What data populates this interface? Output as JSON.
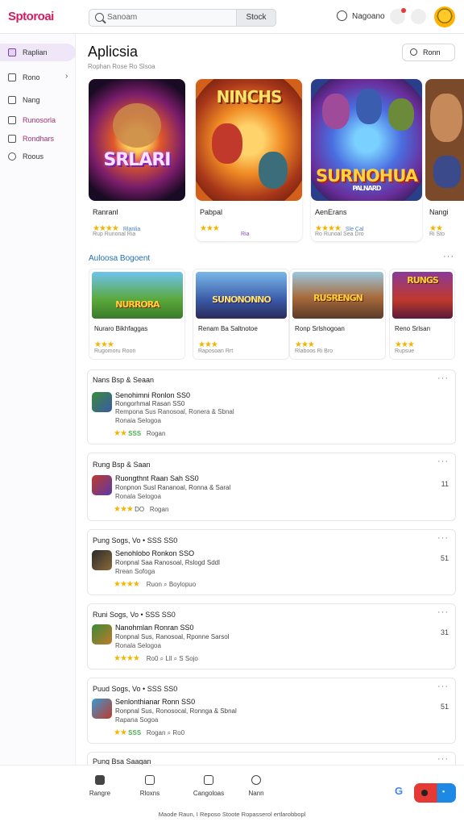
{
  "header": {
    "logo": "Sptoroai",
    "search_placeholder": "Sanoam",
    "search_button": "Stock",
    "user_label": "Nagoano"
  },
  "sidebar": {
    "items": [
      {
        "label": "Raplian",
        "active": true,
        "icon": "bag-icon"
      },
      {
        "label": "Rono",
        "chevron": "›",
        "icon": "grid-icon"
      },
      {
        "label": "Nang",
        "icon": "square-icon"
      },
      {
        "label": "Runosorla",
        "icon": "archive-icon"
      },
      {
        "label": "Rondhars",
        "icon": "chat-icon"
      },
      {
        "label": "Roous",
        "icon": "circle-icon"
      }
    ]
  },
  "page": {
    "title": "Aplicsia",
    "subtitle": "Rophan Rose Ro Slsoa",
    "search_button": "Ronn"
  },
  "featured": [
    {
      "art_title": "SRLARI",
      "name": "Ranranl",
      "stars": "★★★★",
      "meta": "Rlanlia",
      "sub": "Rup Runonal  Ria"
    },
    {
      "art_title": "NINCHS",
      "name": "Pabpal",
      "stars": "★★★",
      "meta": "",
      "sub": "Ria"
    },
    {
      "art_title": "SURNOHUA",
      "art_sub": "PALNARD",
      "name": "AenErans",
      "stars": "★★★★",
      "meta": "Sle Cal",
      "sub": "Ro Runoal Sea Dro"
    },
    {
      "art_title": "",
      "name": "Nangi",
      "stars": "★★",
      "meta": "",
      "sub": "Ri Sto"
    }
  ],
  "recommended": {
    "heading": "Auloosa Bogoent",
    "items": [
      {
        "art_title": "NURRORA",
        "name": "Nuraro Bikhfaggas",
        "stars": "★★★",
        "sub": "Rugomoru  Roon"
      },
      {
        "art_title": "SUNONONNO",
        "name": "Renam Ba Saltnotoe",
        "stars": "★★★",
        "sub": "Raposoan  Rrt"
      },
      {
        "art_title": "RUSRENGN",
        "name": "Ronp Srlshogoan",
        "stars": "★★★",
        "sub": "Rlaboos   Ri Bro"
      },
      {
        "art_title": "RUNGS",
        "name": "Reno Srlsan",
        "stars": "★★★",
        "sub": "Rupsue"
      }
    ]
  },
  "reviews": [
    {
      "header": "Nans Bsp & Seaan",
      "title": "Senohimni  Ronlon  SS0",
      "line2": "Rongorhmal Rasan  SS0",
      "line3": "Rempona Sus  Ranosoal,  Ronera  & Sbnal",
      "line4": "Ronaia  Selogoa",
      "stars": "★★",
      "score": "SSS",
      "foot": "Rogan",
      "side": ""
    },
    {
      "header": "Rung Bsp & Saan",
      "title": "Ruongthnt Raan  Sah  SS0",
      "line2": "Ronpnon Susl  Rananoal,  Ronna  & Saral",
      "line3": "Ronala  Selogoa",
      "line4": "",
      "stars": "★★★",
      "score": "DO",
      "foot": "Rogan",
      "side": "11"
    },
    {
      "header": "Pung Sogs, Vo • SSS SS0",
      "title": "Senohlobo  Ronkon  SSO",
      "line2": "Ronpnal  Saa  Ranosoal,  Rslogd  Sddl",
      "line3": "Rrean Sofoga",
      "line4": "",
      "stars": "★★★★",
      "score": "",
      "foot": "Ruon   ⌕ Boylopuo",
      "side": "51"
    },
    {
      "header": "Runi Sogs, Vo • SSS SS0",
      "title": "Nanohmlan Ronran  SS0",
      "line2": "Ronpnal  Sus,  Ranosoal,  Rponne  Sarsol",
      "line3": "Ronala  Selogoa",
      "line4": "",
      "stars": "★★★★",
      "score": "",
      "foot": "Ro0   ⌕   Lll        ⌕  S  Sojo",
      "side": "31"
    },
    {
      "header": "Puud Sogs, Vo • SSS SS0",
      "title": "Senlonthianar  Ronn  SS0",
      "line2": "Ronpnal  Sus,  Ronosocal,  Ronnga  & Sbnal",
      "line3": "Rapana  Sogoa",
      "line4": "",
      "stars": "★★",
      "score": "SSS",
      "foot": "Rogan                      ⌕  Ro0",
      "side": "51"
    }
  ],
  "partial_card": {
    "header": "Pung Bsa Saagan"
  },
  "bottom_nav": [
    {
      "label": "Rangre",
      "icon": "home-icon"
    },
    {
      "label": "Rloxns",
      "icon": "news-icon"
    },
    {
      "label": "Cangoloas",
      "icon": "image-icon"
    },
    {
      "label": "Nann",
      "icon": "chat-icon"
    }
  ],
  "footer": "Maode Raun,  I  Reposo  Stoote  Ropasserol ertlarobbopl"
}
